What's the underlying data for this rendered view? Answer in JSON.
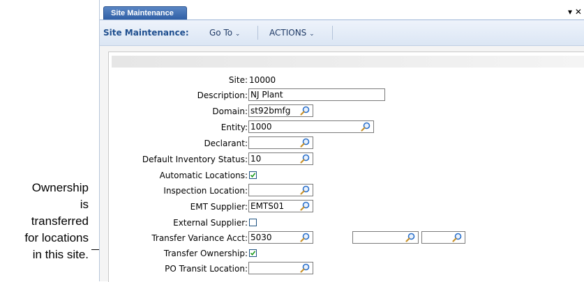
{
  "callout": {
    "lines": [
      "Ownership",
      "is",
      "transferred",
      "for locations",
      "in this site."
    ]
  },
  "tab": {
    "label": "Site Maintenance",
    "dropdown_icon": "triangle-down-icon",
    "close_icon": "close-icon"
  },
  "menubar": {
    "title": "Site Maintenance:",
    "goto": "Go To",
    "actions": "ACTIONS"
  },
  "form": {
    "site_label": "Site:",
    "site_value": "10000",
    "description_label": "Description:",
    "description_value": "NJ Plant",
    "domain_label": "Domain:",
    "domain_value": "st92bmfg",
    "entity_label": "Entity:",
    "entity_value": "1000",
    "declarant_label": "Declarant:",
    "declarant_value": "",
    "inv_status_label": "Default Inventory Status:",
    "inv_status_value": "10",
    "auto_locations_label": "Automatic Locations:",
    "auto_locations_checked": true,
    "inspection_label": "Inspection Location:",
    "inspection_value": "",
    "emt_label": "EMT Supplier:",
    "emt_value": "EMTS01",
    "external_label": "External Supplier:",
    "external_checked": false,
    "variance_label": "Transfer Variance Acct:",
    "variance_value": "5030",
    "variance_sub": "",
    "variance_cc": "",
    "transfer_label": "Transfer Ownership:",
    "transfer_checked": true,
    "po_transit_label": "PO Transit Location:",
    "po_transit_value": ""
  },
  "colors": {
    "tab": "#2f5fa5",
    "menu_title": "#1f4f8f",
    "checkbox": "#1c5180",
    "check_mark": "#1a9a1a",
    "lens": "#2a6fc9"
  }
}
